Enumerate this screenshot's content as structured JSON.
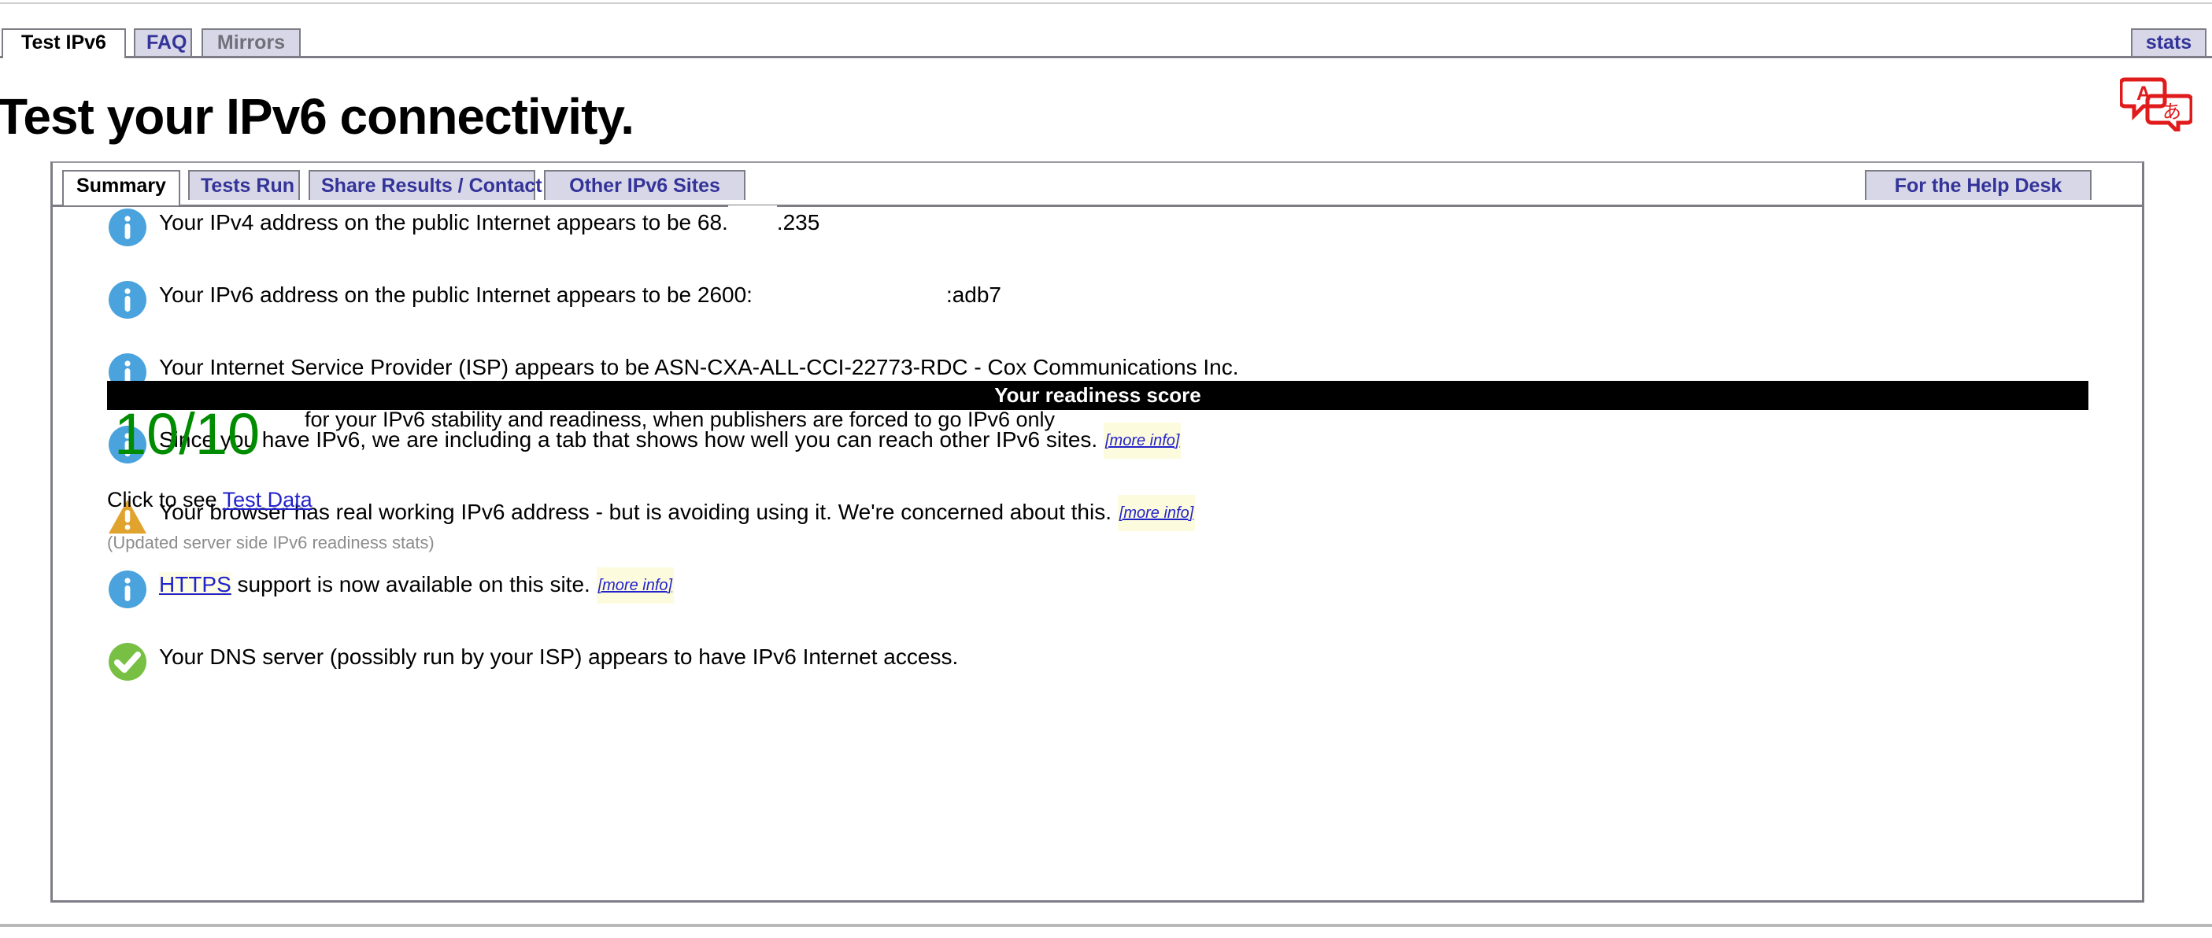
{
  "browser": {
    "top_rule": true,
    "bottom_rule": true
  },
  "nav": {
    "tabs": [
      {
        "label": "Test IPv6",
        "active": true,
        "muted": false
      },
      {
        "label": "FAQ",
        "active": false,
        "muted": false
      },
      {
        "label": "Mirrors",
        "active": false,
        "muted": true
      }
    ],
    "stats_label": "stats"
  },
  "header": {
    "title": "Test your IPv6 connectivity.",
    "translate_icon": "translate-icon",
    "translate_glyph_latin": "A",
    "translate_glyph_japanese": "あ"
  },
  "panel": {
    "tabs": [
      {
        "label": "Summary",
        "active": true
      },
      {
        "label": "Tests Run",
        "active": false
      },
      {
        "label": "Share Results / Contact",
        "active": false
      },
      {
        "label": "Other IPv6 Sites",
        "active": false
      }
    ],
    "help_desk_label": "For the Help Desk"
  },
  "results": [
    {
      "icon": "info-icon",
      "icon_kind": "info",
      "text_before": "Your IPv4 address on the public Internet appears to be 68.",
      "redacted": true,
      "redact_id": "redact-v4",
      "text_after": ".235",
      "more_info": null,
      "link": null
    },
    {
      "icon": "info-icon",
      "icon_kind": "info",
      "text_before": "Your IPv6 address on the public Internet appears to be 2600:",
      "redacted": true,
      "redact_id": "redact-v6",
      "text_after": ":adb7",
      "more_info": null,
      "link": null
    },
    {
      "icon": "info-icon",
      "icon_kind": "info",
      "text_before": "Your Internet Service Provider (ISP) appears to be ASN-CXA-ALL-CCI-22773-RDC - Cox Communications Inc.",
      "redacted": false,
      "text_after": "",
      "more_info": null,
      "link": null
    },
    {
      "icon": "info-icon",
      "icon_kind": "info",
      "text_before": "Since you have IPv6, we are including a tab that shows how well you can reach other IPv6 sites.",
      "redacted": false,
      "text_after": "",
      "more_info": "[more info]",
      "link": null
    },
    {
      "icon": "warning-icon",
      "icon_kind": "warning",
      "text_before": "Your browser has real working IPv6 address - but is avoiding using it. We're concerned about this.",
      "redacted": false,
      "text_after": "",
      "more_info": "[more info]",
      "link": null
    },
    {
      "icon": "info-icon",
      "icon_kind": "info",
      "text_before": "",
      "redacted": false,
      "link": "HTTPS",
      "text_after": " support is now available on this site.",
      "more_info": "[more info]"
    },
    {
      "icon": "success-icon",
      "icon_kind": "success",
      "text_before": "Your DNS server (possibly run by your ISP) appears to have IPv6 Internet access.",
      "redacted": false,
      "text_after": "",
      "more_info": null,
      "link": null
    }
  ],
  "score": {
    "bar_label": "Your readiness score",
    "value": "10/10",
    "caption": "for your IPv6 stability and readiness, when publishers are forced to go IPv6 only",
    "color": "#008c00"
  },
  "footer": {
    "test_data_prefix": "Click to see ",
    "test_data_link": "Test Data",
    "updated_note": "(Updated server side IPv6 readiness stats)"
  },
  "colors": {
    "tab_inactive_bg": "#d7d7e8",
    "tab_border": "#7d7d85",
    "link": "#2222cc",
    "tab_text": "#333399",
    "info": "#4aa3dd",
    "warning": "#e0a32e",
    "success": "#77c043",
    "score_green": "#008c00",
    "highlight": "#fcfbdd"
  }
}
